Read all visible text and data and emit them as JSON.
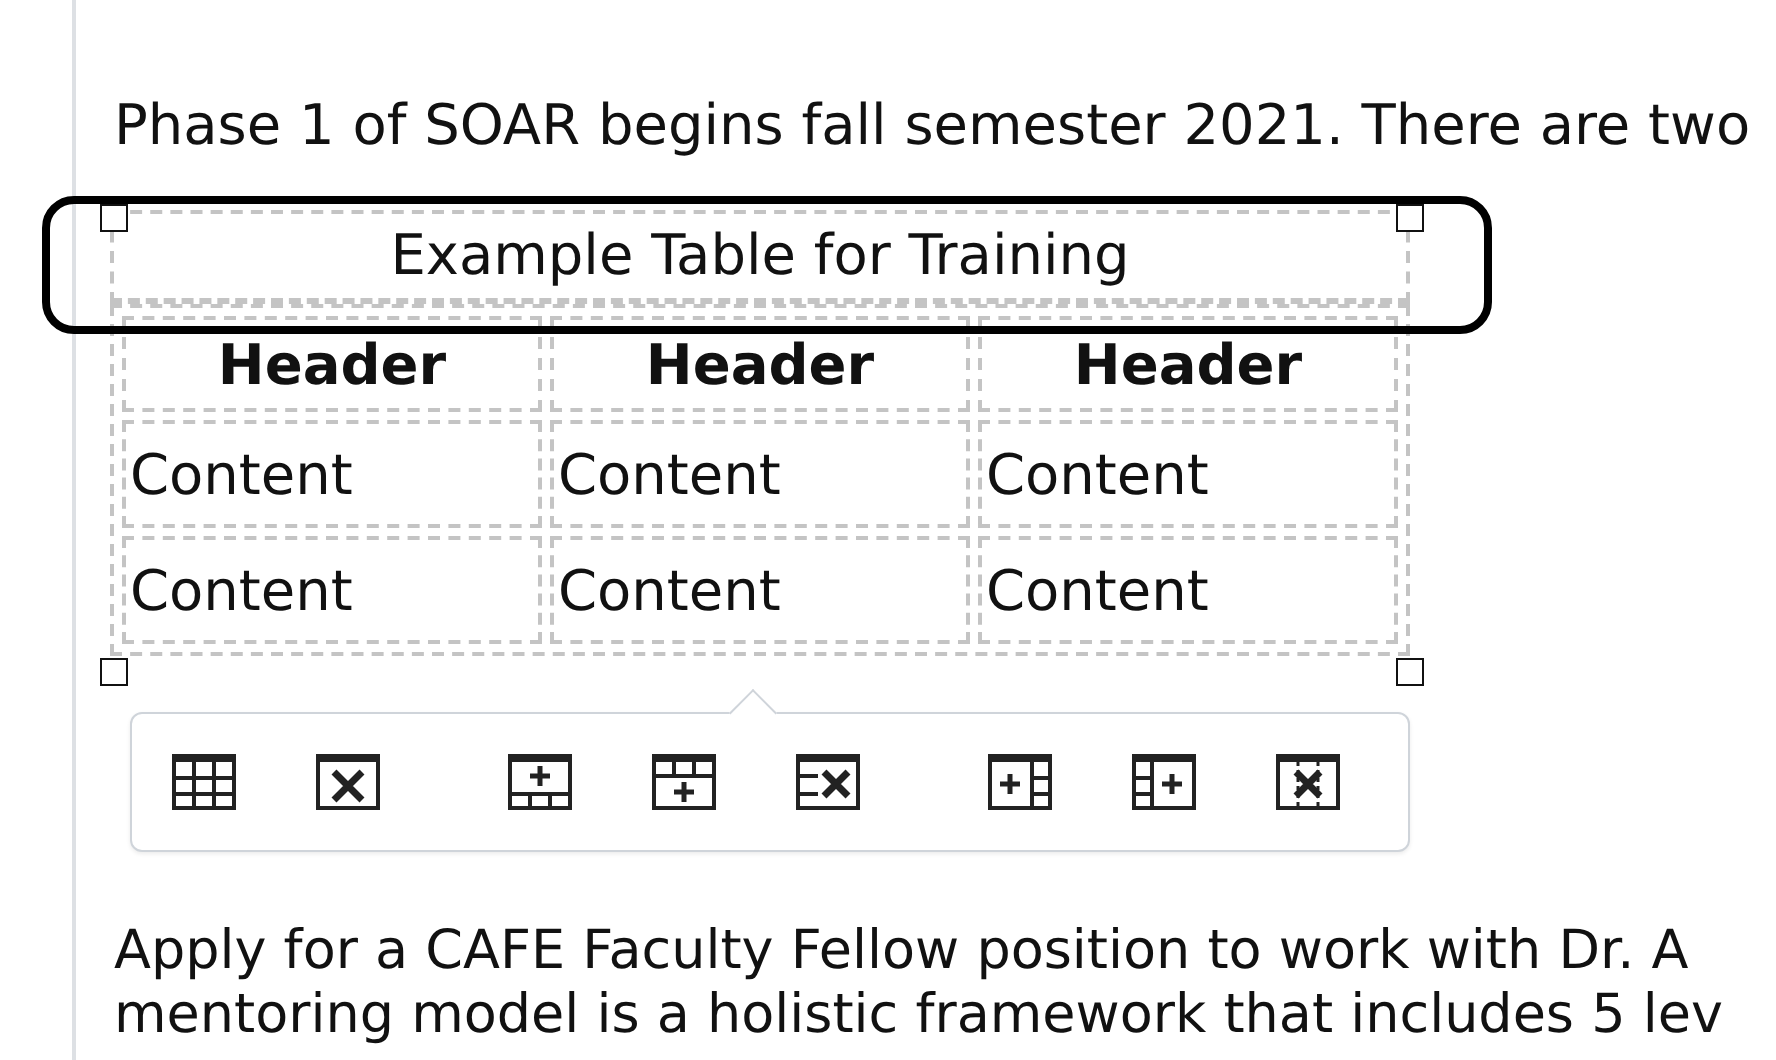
{
  "intro": "Phase 1 of SOAR begins fall semester 2021. There are two",
  "table": {
    "caption": "Example Table for Training",
    "columns": [
      "Header",
      "Header",
      "Header"
    ],
    "rows": [
      [
        "Content",
        "Content",
        "Content"
      ],
      [
        "Content",
        "Content",
        "Content"
      ]
    ]
  },
  "toolbar": {
    "buttons": [
      {
        "kind": "table-properties"
      },
      {
        "kind": "delete-table"
      },
      {
        "kind": "row-before"
      },
      {
        "kind": "row-after"
      },
      {
        "kind": "delete-row"
      },
      {
        "kind": "col-before"
      },
      {
        "kind": "col-after"
      },
      {
        "kind": "delete-col"
      }
    ]
  },
  "paragraph": {
    "lines": [
      "Apply for a CAFE Faculty Fellow position to work with Dr. A",
      "mentoring model is a holistic framework that includes 5 lev"
    ]
  }
}
